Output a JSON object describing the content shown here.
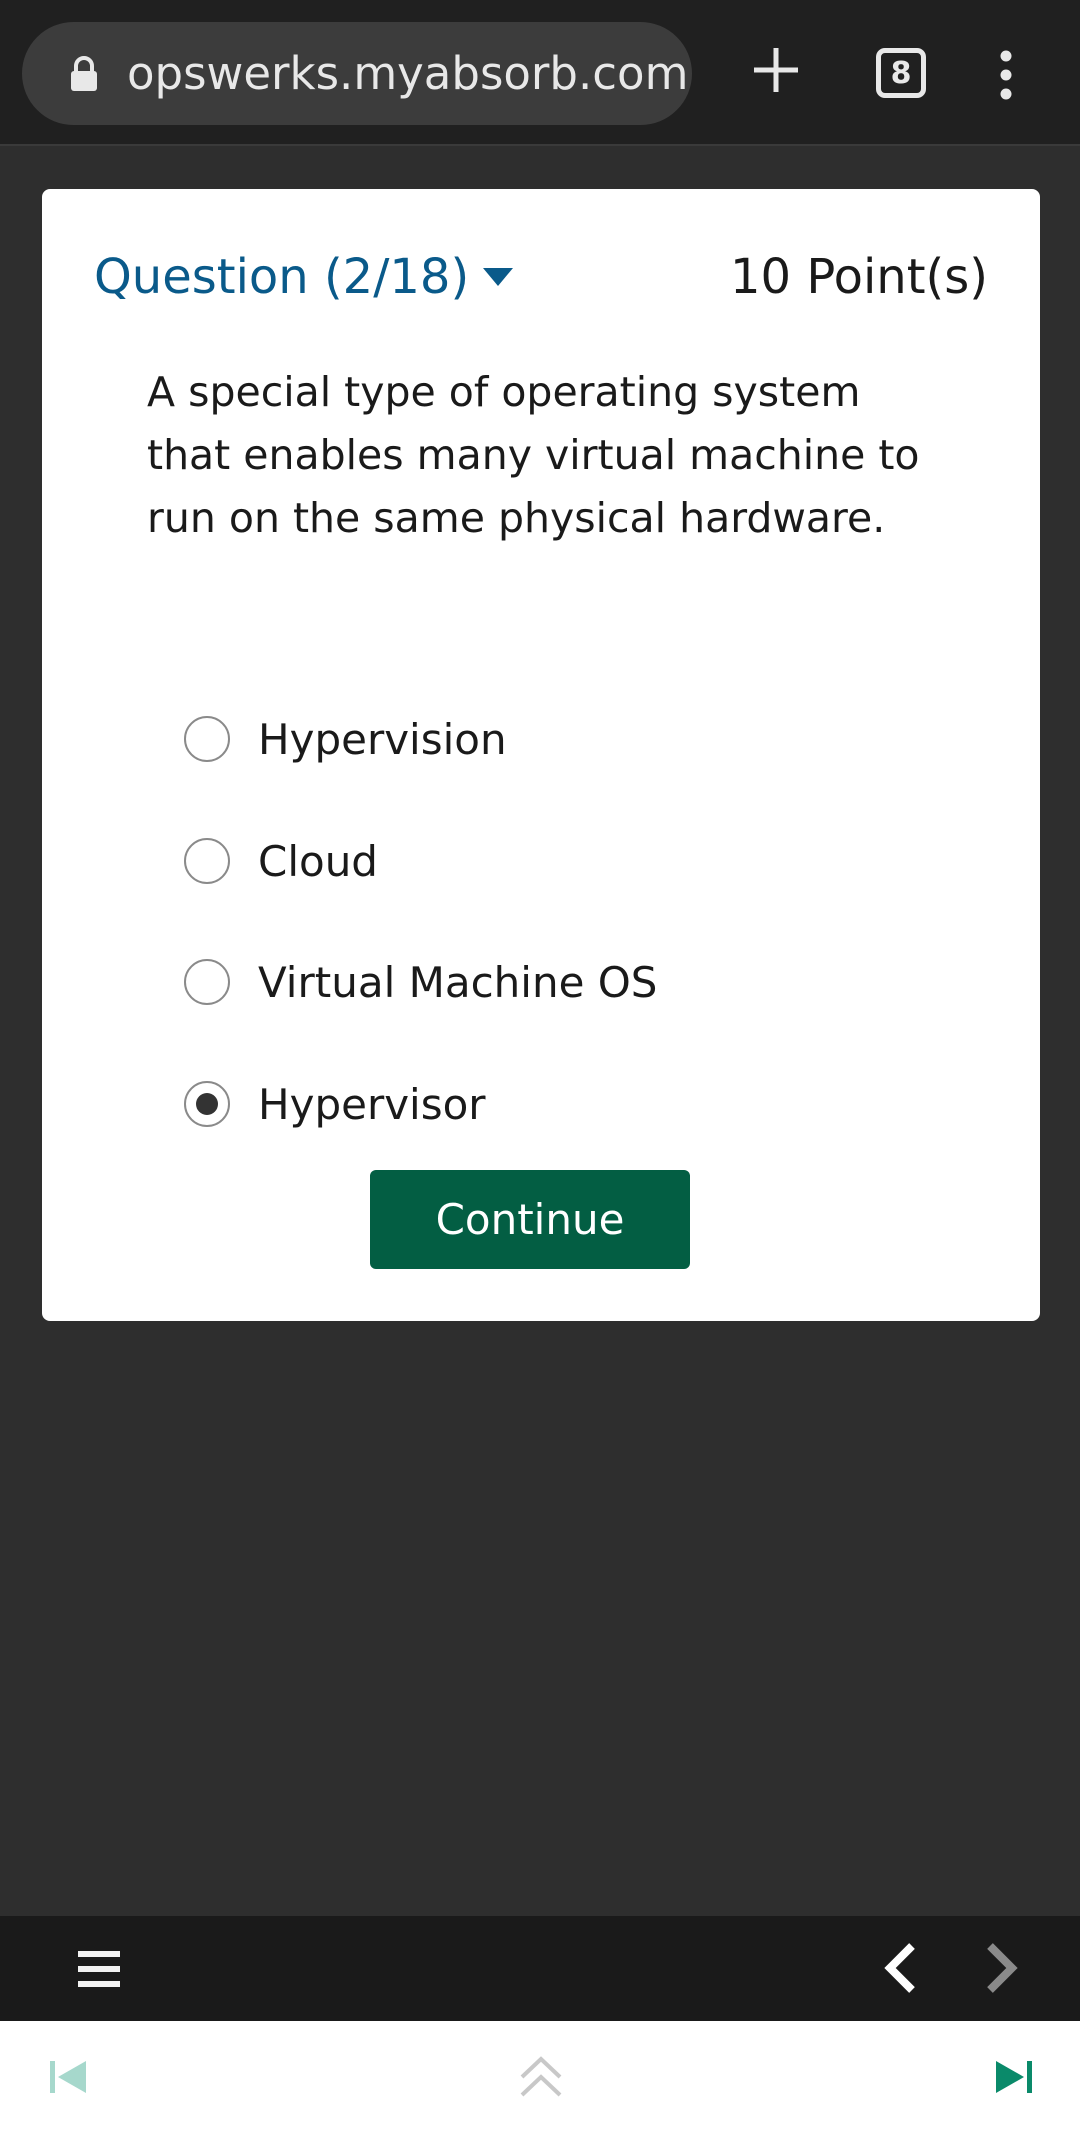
{
  "browser": {
    "url": "opswerks.myabsorb.com.au",
    "tab_count": "8"
  },
  "question": {
    "header": "Question (2/18)",
    "points": "10 Point(s)",
    "text": "A special type of operating system that enables many virtual machine to run on the same physical hardware.",
    "options": [
      {
        "label": "Hypervision",
        "selected": false
      },
      {
        "label": "Cloud",
        "selected": false
      },
      {
        "label": "Virtual Machine OS",
        "selected": false
      },
      {
        "label": "Hypervisor",
        "selected": true
      }
    ],
    "continue_label": "Continue"
  },
  "colors": {
    "accent_blue": "#0a5a8a",
    "button_green": "#035e43",
    "skip_forward_green": "#0a8a6a",
    "skip_back_disabled": "#a6d8cc",
    "page_background": "#2e2e2e"
  },
  "icons": {
    "lock": "lock-icon",
    "new_tab": "plus-icon",
    "tabs": "tabs-icon",
    "browser_menu": "more-vert-icon",
    "app_menu": "hamburger-icon",
    "previous": "chevron-left-icon",
    "next": "chevron-right-icon",
    "skip_back": "skip-previous-icon",
    "scroll_up": "double-chevron-up-icon",
    "skip_forward": "skip-next-icon"
  }
}
